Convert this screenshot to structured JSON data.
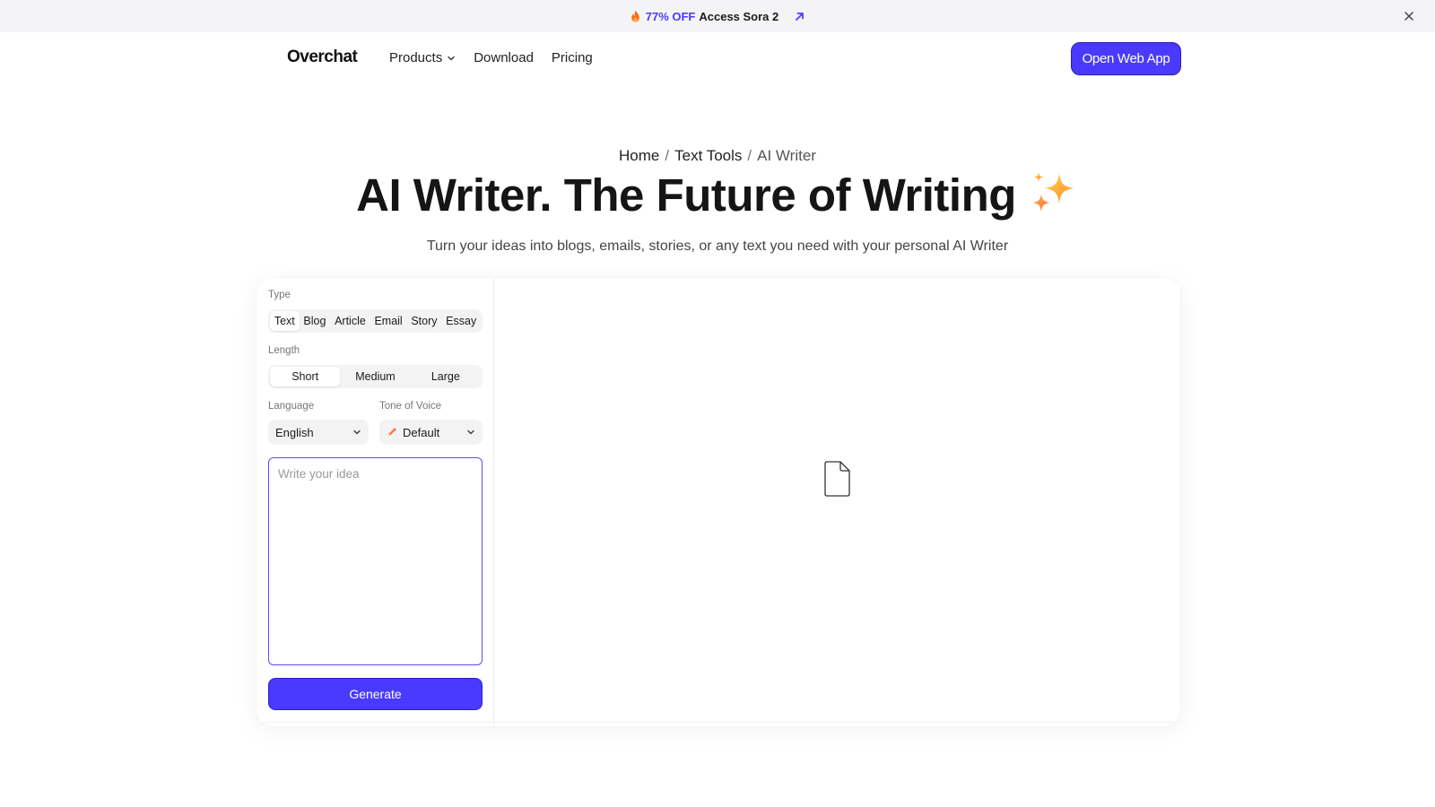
{
  "promo": {
    "discount": "77% OFF",
    "text": "Access Sora 2"
  },
  "nav": {
    "logo": "Overchat",
    "links": [
      "Products",
      "Download",
      "Pricing"
    ],
    "cta": "Open Web App"
  },
  "breadcrumb": {
    "items": [
      "Home",
      "Text Tools",
      "AI Writer"
    ],
    "separator": "/"
  },
  "hero": {
    "title": "AI Writer. The Future of Writing",
    "subtitle": "Turn your ideas into blogs, emails, stories, or any text you need with your personal AI Writer"
  },
  "tool": {
    "type_label": "Type",
    "types": [
      "Text",
      "Blog",
      "Article",
      "Email",
      "Story",
      "Essay"
    ],
    "type_selected": "Text",
    "length_label": "Length",
    "lengths": [
      "Short",
      "Medium",
      "Large"
    ],
    "length_selected": "Short",
    "language_label": "Language",
    "language_value": "English",
    "tone_label": "Tone of Voice",
    "tone_value": "Default",
    "idea_placeholder": "Write your idea",
    "idea_value": "",
    "generate_label": "Generate"
  },
  "colors": {
    "accent": "#4a3aff",
    "promo_bg": "#f4f4f6",
    "segment_bg": "#f3f3f4"
  },
  "icons": {
    "promo": "fire-icon",
    "promo_link": "arrow-up-right-icon",
    "close": "close-icon",
    "dropdown": "chevron-down-icon",
    "hero": "sparkles-icon",
    "tone": "pencil-icon",
    "output_placeholder": "document-icon"
  }
}
